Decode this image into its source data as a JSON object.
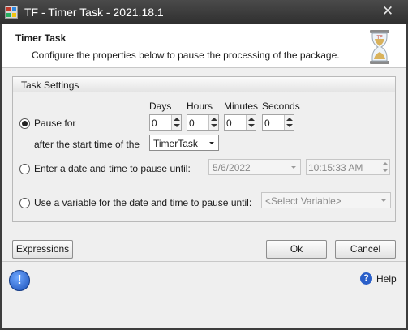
{
  "window": {
    "title": "TF - Timer Task - 2021.18.1",
    "close_glyph": "✕"
  },
  "header": {
    "title": "Timer Task",
    "description": "Configure the properties below to pause the processing of the package.",
    "icon": "hourglass-icon"
  },
  "group": {
    "title": "Task Settings",
    "columns": [
      "Days",
      "Hours",
      "Minutes",
      "Seconds"
    ],
    "pause_for": {
      "label": "Pause for",
      "selected": true,
      "values": [
        "0",
        "0",
        "0",
        "0"
      ],
      "after_label": "after the start time of the",
      "after_value": "TimerTask"
    },
    "date_time": {
      "label": "Enter a date and time to pause until:",
      "selected": false,
      "date": "5/6/2022",
      "time": "10:15:33 AM"
    },
    "variable": {
      "label": "Use a variable for the date and time to pause until:",
      "selected": false,
      "placeholder": "<Select Variable>"
    }
  },
  "buttons": {
    "expressions": "Expressions",
    "ok": "Ok",
    "cancel": "Cancel"
  },
  "footer": {
    "info_glyph": "!",
    "help_glyph": "?",
    "help_label": "Help"
  },
  "colors": {
    "titlebar": "#3c3c3c",
    "accent_blue": "#2a5fc9"
  }
}
